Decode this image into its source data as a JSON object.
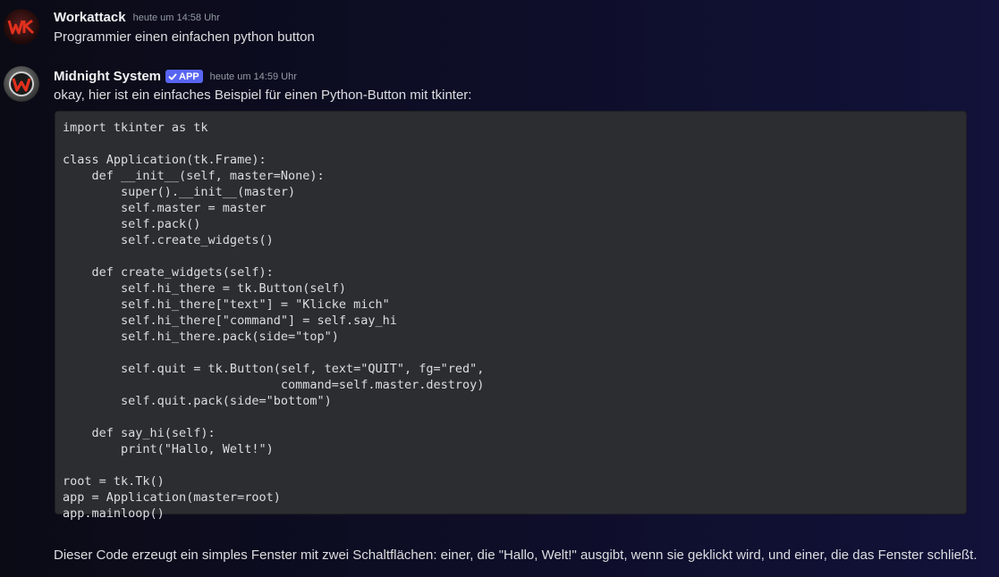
{
  "messages": [
    {
      "author": "Workattack",
      "timestamp": "heute um 14:58 Uhr",
      "avatar_icon": "wk-logo-avatar",
      "text": "Programmier einen einfachen python button"
    },
    {
      "author": "Midnight System",
      "badge": "APP",
      "badge_icon": "checkmark-icon",
      "timestamp": "heute um 14:59 Uhr",
      "avatar_icon": "w-logo-avatar",
      "intro": "okay, hier ist ein einfaches Beispiel für einen Python-Button mit tkinter:",
      "code_language": "python",
      "code_lines": [
        "import tkinter as tk",
        "",
        "class Application(tk.Frame):",
        "    def __init__(self, master=None):",
        "        super().__init__(master)",
        "        self.master = master",
        "        self.pack()",
        "        self.create_widgets()",
        "",
        "    def create_widgets(self):",
        "        self.hi_there = tk.Button(self)",
        "        self.hi_there[\"text\"] = \"Klicke mich\"",
        "        self.hi_there[\"command\"] = self.say_hi",
        "        self.hi_there.pack(side=\"top\")",
        "",
        "        self.quit = tk.Button(self, text=\"QUIT\", fg=\"red\",",
        "                              command=self.master.destroy)",
        "        self.quit.pack(side=\"bottom\")",
        "",
        "    def say_hi(self):",
        "        print(\"Hallo, Welt!\")",
        "",
        "root = tk.Tk()",
        "app = Application(master=root)",
        "app.mainloop()"
      ],
      "outro": "Dieser Code erzeugt ein simples Fenster mit zwei Schaltflächen: einer, die \"Hallo, Welt!\" ausgibt, wenn sie geklickt wird, und einer, die das Fenster schließt."
    }
  ],
  "colors": {
    "background": "#0e0e2a",
    "code_background": "#2b2d31",
    "badge": "#5865f2",
    "username": "#f2f3f5",
    "timestamp": "#949ba4",
    "text": "#dbdee1"
  }
}
